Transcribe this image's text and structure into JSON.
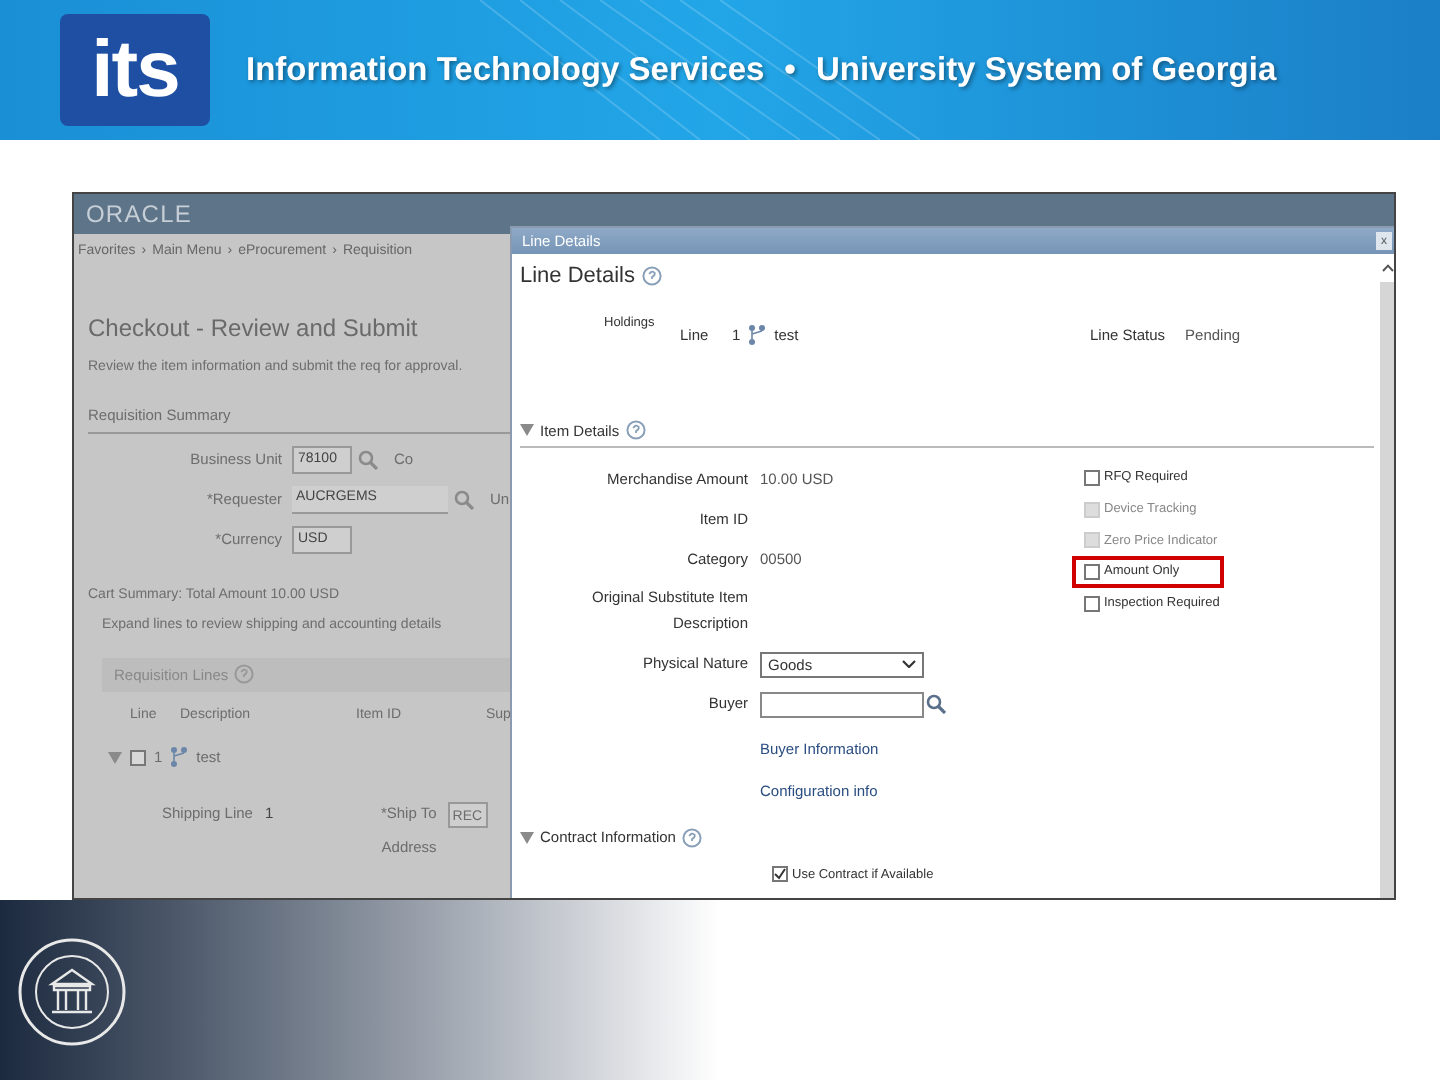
{
  "slide_header": {
    "logo": "its",
    "title": "Information Technology Services",
    "separator": "•",
    "subtitle": "University System of Georgia"
  },
  "background_page": {
    "brand": "ORACLE",
    "breadcrumbs": [
      "Favorites",
      "Main Menu",
      "eProcurement",
      "Requisition"
    ],
    "breadcrumb_separator": "›",
    "heading": "Checkout - Review and Submit",
    "instruction": "Review the item information and submit the req for approval.",
    "summary_title": "Requisition Summary",
    "fields": [
      {
        "label": "Business Unit",
        "value": "78100",
        "lookup": true,
        "side_text": "Co"
      },
      {
        "label": "*Requester",
        "value": "AUCRGEMS",
        "lookup": true,
        "side_text": "Un"
      },
      {
        "label": "*Currency",
        "value": "USD",
        "lookup": false
      }
    ],
    "cart_summary": "Cart Summary: Total Amount 10.00 USD",
    "expand_hint": "Expand lines to review shipping and accounting details",
    "lines_title": "Requisition Lines",
    "columns": [
      "Line",
      "Description",
      "Item ID",
      "Sup"
    ],
    "row": {
      "line": "1",
      "description": "test",
      "expanded": true,
      "checked": false
    },
    "shipping": {
      "label": "Shipping Line",
      "value": "1",
      "ship_to_label": "*Ship To",
      "ship_to_value": "REC",
      "address_label": "Address"
    }
  },
  "dialog": {
    "title": "Line Details",
    "close": "x",
    "heading": "Line Details",
    "holdings_label": "Holdings",
    "line_label": "Line",
    "line_value": "1",
    "line_description": "test",
    "status_label": "Line Status",
    "status_value": "Pending",
    "item_section": {
      "title": "Item Details",
      "expanded": true
    },
    "item_fields": [
      {
        "label": "Merchandise Amount",
        "value": "10.00 USD"
      },
      {
        "label": "Item ID"
      },
      {
        "label": "Category",
        "value": "00500"
      },
      {
        "label": "Original Substitute Item Description"
      }
    ],
    "physical_nature": {
      "label": "Physical Nature",
      "value": "Goods"
    },
    "buyer": {
      "label": "Buyer"
    },
    "links": [
      "Buyer Information",
      "Configuration info"
    ],
    "options": [
      {
        "label": "RFQ Required",
        "checked": false,
        "disabled": false,
        "highlighted": false
      },
      {
        "label": "Device Tracking",
        "checked": false,
        "disabled": true,
        "highlighted": false
      },
      {
        "label": "Zero Price Indicator",
        "checked": false,
        "disabled": true,
        "highlighted": false
      },
      {
        "label": "Amount Only",
        "checked": false,
        "disabled": false,
        "highlighted": true
      },
      {
        "label": "Inspection Required",
        "checked": false,
        "disabled": false,
        "highlighted": false
      }
    ],
    "contract_section": {
      "title": "Contract Information",
      "expanded": true
    },
    "use_contract": {
      "label": "Use Contract if Available",
      "checked": true
    }
  }
}
